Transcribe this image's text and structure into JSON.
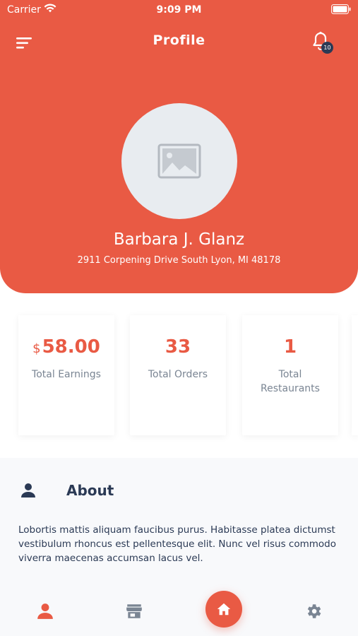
{
  "status_bar": {
    "carrier": "Carrier",
    "time": "9:09 PM"
  },
  "header": {
    "title": "Profile",
    "notification_count": "10"
  },
  "profile": {
    "name": "Barbara J. Glanz",
    "address": "2911 Corpening Drive South Lyon, MI 48178"
  },
  "stats": [
    {
      "currency": "$",
      "value": "58.00",
      "label": "Total Earnings"
    },
    {
      "value": "33",
      "label": "Total Orders"
    },
    {
      "value": "1",
      "label": "Total Restaurants"
    }
  ],
  "about": {
    "title": "About",
    "text": "Lobortis mattis aliquam faucibus purus. Habitasse platea dictumst vestibulum rhoncus est pellentesque elit. Nunc vel risus commodo viverra maecenas accumsan lacus vel."
  },
  "colors": {
    "accent": "#e95a44",
    "dark": "#2b3a55",
    "muted": "#7a8593",
    "avatar_bg": "#e8ecf0"
  },
  "bottom_nav": [
    "person-icon",
    "store-icon",
    "home-icon",
    "gear-icon"
  ]
}
